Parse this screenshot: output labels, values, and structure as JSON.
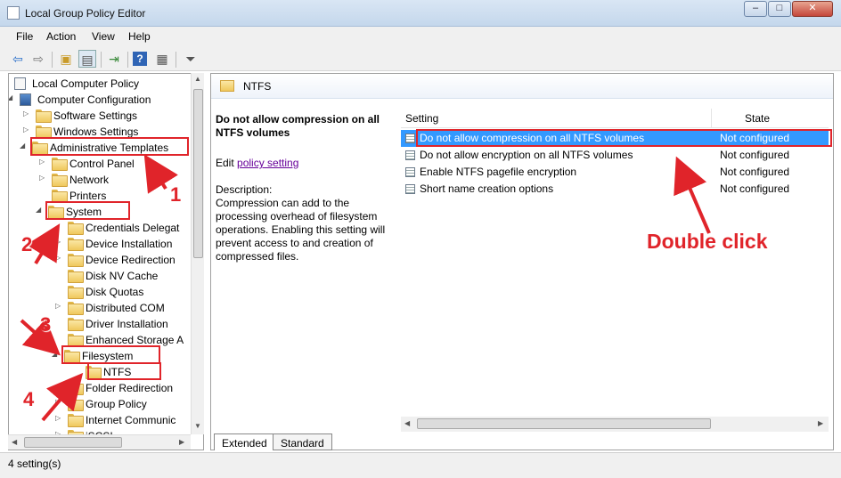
{
  "window": {
    "title": "Local Group Policy Editor",
    "minimize": "–",
    "maximize": "□",
    "close": "✕"
  },
  "menu": [
    "File",
    "Action",
    "View",
    "Help"
  ],
  "tree": [
    {
      "label": "Local Computer Policy",
      "kind": "policy"
    },
    {
      "label": "Computer Configuration",
      "kind": "computer",
      "expander": "◢"
    },
    {
      "label": "Software Settings",
      "kind": "folder",
      "expander": "▷"
    },
    {
      "label": "Windows Settings",
      "kind": "folder",
      "expander": "▷"
    },
    {
      "label": "Administrative Templates",
      "kind": "folder",
      "expander": "◢"
    },
    {
      "label": "Control Panel",
      "kind": "folder",
      "expander": "▷"
    },
    {
      "label": "Network",
      "kind": "folder",
      "expander": "▷"
    },
    {
      "label": "Printers",
      "kind": "folder",
      "expander": ""
    },
    {
      "label": "System",
      "kind": "folder",
      "expander": "◢"
    },
    {
      "label": "Credentials Delegat",
      "kind": "folder",
      "expander": ""
    },
    {
      "label": "Device Installation",
      "kind": "folder",
      "expander": "▷"
    },
    {
      "label": "Device Redirection",
      "kind": "folder",
      "expander": "▷"
    },
    {
      "label": "Disk NV Cache",
      "kind": "folder",
      "expander": ""
    },
    {
      "label": "Disk Quotas",
      "kind": "folder",
      "expander": ""
    },
    {
      "label": "Distributed COM",
      "kind": "folder",
      "expander": "▷"
    },
    {
      "label": "Driver Installation",
      "kind": "folder",
      "expander": ""
    },
    {
      "label": "Enhanced Storage A",
      "kind": "folder",
      "expander": ""
    },
    {
      "label": "Filesystem",
      "kind": "folder",
      "expander": "◢"
    },
    {
      "label": "NTFS",
      "kind": "folder",
      "expander": ""
    },
    {
      "label": "Folder Redirection",
      "kind": "folder",
      "expander": ""
    },
    {
      "label": "Group Policy",
      "kind": "folder",
      "expander": "▷"
    },
    {
      "label": "Internet Communic",
      "kind": "folder",
      "expander": "▷"
    },
    {
      "label": "iSCSI",
      "kind": "folder",
      "expander": "▷"
    }
  ],
  "right": {
    "header": "NTFS",
    "desc_title": "Do not allow compression on all NTFS volumes",
    "edit_prefix": "Edit",
    "edit_link": "policy setting",
    "desc_label": "Description:",
    "desc_text": "Compression can add to the processing overhead of filesystem operations.  Enabling this setting will prevent access to and creation of compressed files.",
    "col_setting": "Setting",
    "col_state": "State",
    "rows": [
      {
        "name": "Do not allow compression on all NTFS volumes",
        "state": "Not configured"
      },
      {
        "name": "Do not allow encryption on all NTFS volumes",
        "state": "Not configured"
      },
      {
        "name": "Enable NTFS pagefile encryption",
        "state": "Not configured"
      },
      {
        "name": "Short name creation options",
        "state": "Not configured"
      }
    ]
  },
  "tabs": [
    "Extended",
    "Standard"
  ],
  "status": "4 setting(s)",
  "annotations": {
    "n1": "1",
    "n2": "2",
    "n3": "3",
    "n4": "4",
    "double_click": "Double click"
  },
  "colors": {
    "annotation_red": "#e0242a",
    "selection_blue": "#3399ff"
  }
}
